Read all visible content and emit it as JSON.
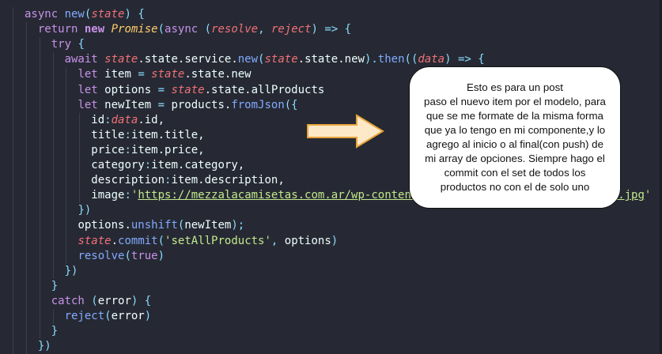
{
  "code_lines": [
    [
      [
        "k",
        "async "
      ],
      [
        "f",
        "new"
      ],
      [
        "p",
        "("
      ],
      [
        "v",
        "state"
      ],
      [
        "p",
        ") {"
      ]
    ],
    [
      [
        "k",
        "return "
      ],
      [
        "kb",
        "new "
      ],
      [
        "c",
        "Promise"
      ],
      [
        "p",
        "("
      ],
      [
        "k",
        "async "
      ],
      [
        "p",
        "("
      ],
      [
        "v",
        "resolve"
      ],
      [
        "p",
        ", "
      ],
      [
        "v",
        "reject"
      ],
      [
        "p",
        ") => {"
      ]
    ],
    [
      [
        "k",
        "try "
      ],
      [
        "p",
        "{"
      ]
    ],
    [
      [
        "k",
        "await "
      ],
      [
        "v",
        "state"
      ],
      [
        "n",
        ".state.service."
      ],
      [
        "f",
        "new"
      ],
      [
        "p",
        "("
      ],
      [
        "v",
        "state"
      ],
      [
        "n",
        ".state.new"
      ],
      [
        "p",
        ")."
      ],
      [
        "f",
        "then"
      ],
      [
        "p",
        "(("
      ],
      [
        "v",
        "data"
      ],
      [
        "p",
        ") => {"
      ]
    ],
    [
      [
        "k",
        "let "
      ],
      [
        "n",
        "item "
      ],
      [
        "p",
        "= "
      ],
      [
        "v",
        "state"
      ],
      [
        "n",
        ".state.new"
      ]
    ],
    [
      [
        "k",
        "let "
      ],
      [
        "n",
        "options "
      ],
      [
        "p",
        "= "
      ],
      [
        "v",
        "state"
      ],
      [
        "n",
        ".state.allProducts"
      ]
    ],
    [
      [
        "k",
        "let "
      ],
      [
        "n",
        "newItem "
      ],
      [
        "p",
        "= "
      ],
      [
        "n",
        "products."
      ],
      [
        "f",
        "fromJson"
      ],
      [
        "p",
        "({"
      ]
    ],
    [
      [
        "n",
        "id"
      ],
      [
        "p",
        ":"
      ],
      [
        "v",
        "data"
      ],
      [
        "n",
        ".id,"
      ]
    ],
    [
      [
        "n",
        "title"
      ],
      [
        "p",
        ":"
      ],
      [
        "n",
        "item.title,"
      ]
    ],
    [
      [
        "n",
        "price"
      ],
      [
        "p",
        ":"
      ],
      [
        "n",
        "item.price,"
      ]
    ],
    [
      [
        "n",
        "category"
      ],
      [
        "p",
        ":"
      ],
      [
        "n",
        "item.category,"
      ]
    ],
    [
      [
        "n",
        "description"
      ],
      [
        "p",
        ":"
      ],
      [
        "n",
        "item.description,"
      ]
    ],
    [
      [
        "n",
        "image"
      ],
      [
        "p",
        ":"
      ],
      [
        "s",
        "'"
      ],
      [
        "url",
        "https://mezzalacamisetas.com.ar/wp-content/uploads/2021/03/camiseta-boca.jpg"
      ],
      [
        "s",
        "'"
      ]
    ],
    [
      [
        "p",
        "})"
      ]
    ],
    [
      [
        "n",
        "options."
      ],
      [
        "f",
        "unshift"
      ],
      [
        "p",
        "("
      ],
      [
        "n",
        "newItem"
      ],
      [
        "p",
        ");"
      ]
    ],
    [
      [
        "v",
        "state"
      ],
      [
        "n",
        "."
      ],
      [
        "f",
        "commit"
      ],
      [
        "p",
        "("
      ],
      [
        "s",
        "'setAllProducts'"
      ],
      [
        "p",
        ", "
      ],
      [
        "n",
        "options"
      ],
      [
        "p",
        ")"
      ]
    ],
    [
      [
        "f",
        "resolve"
      ],
      [
        "p",
        "("
      ],
      [
        "k",
        "true"
      ],
      [
        "p",
        ")"
      ]
    ],
    [
      [
        "p",
        "})"
      ]
    ],
    [
      [
        "p",
        "}"
      ]
    ],
    [
      [
        "k",
        "catch "
      ],
      [
        "p",
        "("
      ],
      [
        "n",
        "error"
      ],
      [
        "p",
        ") {"
      ]
    ],
    [
      [
        "f",
        "reject"
      ],
      [
        "p",
        "("
      ],
      [
        "n",
        "error"
      ],
      [
        "p",
        ")"
      ]
    ],
    [
      [
        "p",
        "}"
      ]
    ],
    [
      [
        "p",
        "})"
      ]
    ]
  ],
  "indents": [
    2,
    3,
    4,
    5,
    6,
    6,
    6,
    7,
    7,
    7,
    7,
    7,
    7,
    6,
    6,
    6,
    6,
    5,
    4,
    4,
    5,
    4,
    3
  ],
  "note": {
    "lines": [
      "Esto es para un post",
      "paso el nuevo item por el modelo, para",
      "que se me formate de la misma forma",
      "que ya lo tengo en mi componente,y lo",
      "agrego al inicio o al final(con push) de",
      "mi array de opciones. Siempre hago el",
      "commit con el set de todos los",
      "productos no con el de solo uno"
    ]
  },
  "colors": {
    "background": "#262933",
    "arrow_fill": "#fde9c8",
    "arrow_stroke": "#e8a33a"
  }
}
